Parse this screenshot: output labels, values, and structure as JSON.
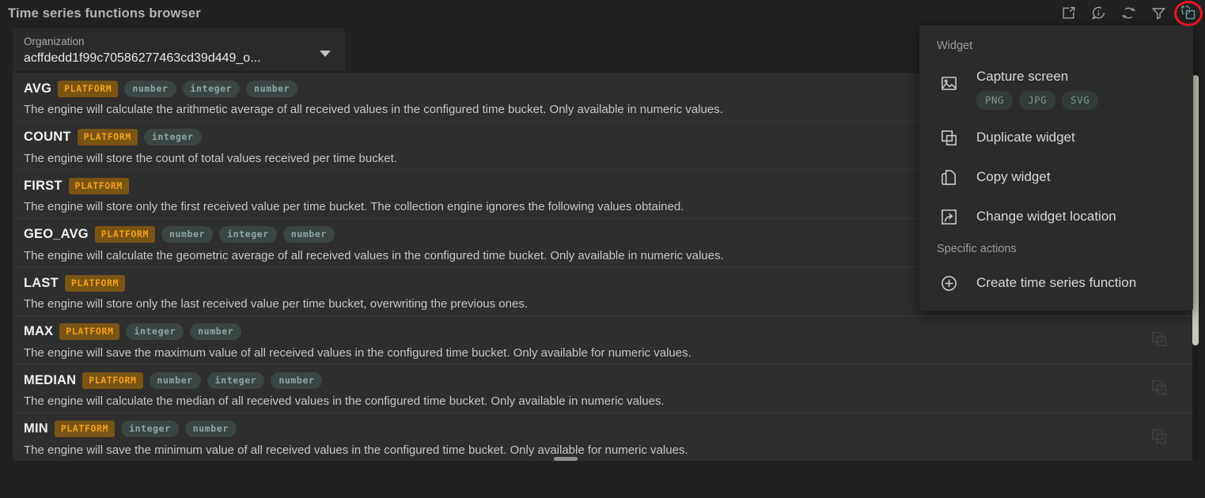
{
  "header": {
    "title": "Time series functions browser",
    "icons": [
      {
        "name": "export-widget-icon",
        "label": "Export widget"
      },
      {
        "name": "info-icon",
        "label": "Information"
      },
      {
        "name": "refresh-icon",
        "label": "Refresh"
      },
      {
        "name": "filter-icon",
        "label": "Filter"
      },
      {
        "name": "widget-actions-icon",
        "label": "Widget actions"
      }
    ],
    "active_icon_color": "#62a39f",
    "highlight_color": "#f0141e"
  },
  "organization_select": {
    "label": "Organization",
    "value": "acffdedd1f99c70586277463cd39d449_o...",
    "caret": "chevron-down-icon"
  },
  "list": {
    "row_action_icon": "copy-icon",
    "rows": [
      {
        "name": "AVG",
        "badges": [
          "PLATFORM",
          "number",
          "integer",
          "number"
        ],
        "description": "The engine will calculate the arithmetic average of all received values in the configured time bucket. Only available in numeric values."
      },
      {
        "name": "COUNT",
        "badges": [
          "PLATFORM",
          "integer"
        ],
        "description": "The engine will store the count of total values received per time bucket."
      },
      {
        "name": "FIRST",
        "badges": [
          "PLATFORM"
        ],
        "description": "The engine will store only the first received value per time bucket. The collection engine ignores the following values obtained."
      },
      {
        "name": "GEO_AVG",
        "badges": [
          "PLATFORM",
          "number",
          "integer",
          "number"
        ],
        "description": "The engine will calculate the geometric average of all received values in the configured time bucket. Only available in numeric values."
      },
      {
        "name": "LAST",
        "badges": [
          "PLATFORM"
        ],
        "description": "The engine will store only the last received value per time bucket, overwriting the previous ones."
      },
      {
        "name": "MAX",
        "badges": [
          "PLATFORM",
          "integer",
          "number"
        ],
        "description": "The engine will save the maximum value of all received values in the configured time bucket. Only available for numeric values."
      },
      {
        "name": "MEDIAN",
        "badges": [
          "PLATFORM",
          "number",
          "integer",
          "number"
        ],
        "description": "The engine will calculate the median of all received values in the configured time bucket. Only available in numeric values."
      },
      {
        "name": "MIN",
        "badges": [
          "PLATFORM",
          "integer",
          "number"
        ],
        "description": "The engine will save the minimum value of all received values in the configured time bucket. Only available for numeric values."
      }
    ]
  },
  "context_menu": {
    "section_widget": "Widget",
    "section_specific": "Specific actions",
    "capture": {
      "label": "Capture screen",
      "icon": "image-icon",
      "formats": [
        "PNG",
        "JPG",
        "SVG"
      ]
    },
    "items": [
      {
        "label": "Duplicate widget",
        "icon": "duplicate-icon"
      },
      {
        "label": "Copy widget",
        "icon": "copy-icon"
      },
      {
        "label": "Change widget location",
        "icon": "move-widget-icon"
      }
    ],
    "specific_items": [
      {
        "label": "Create time series function",
        "icon": "plus-circle-icon"
      }
    ]
  },
  "colors": {
    "background": "#212121",
    "panel": "#2e2e2e",
    "menu": "#2b2b2b",
    "platform_badge_bg": "#7a5414",
    "platform_badge_text": "#f3a21c",
    "type_badge_bg": "#3b4543",
    "type_badge_text": "#8fa8a4"
  }
}
